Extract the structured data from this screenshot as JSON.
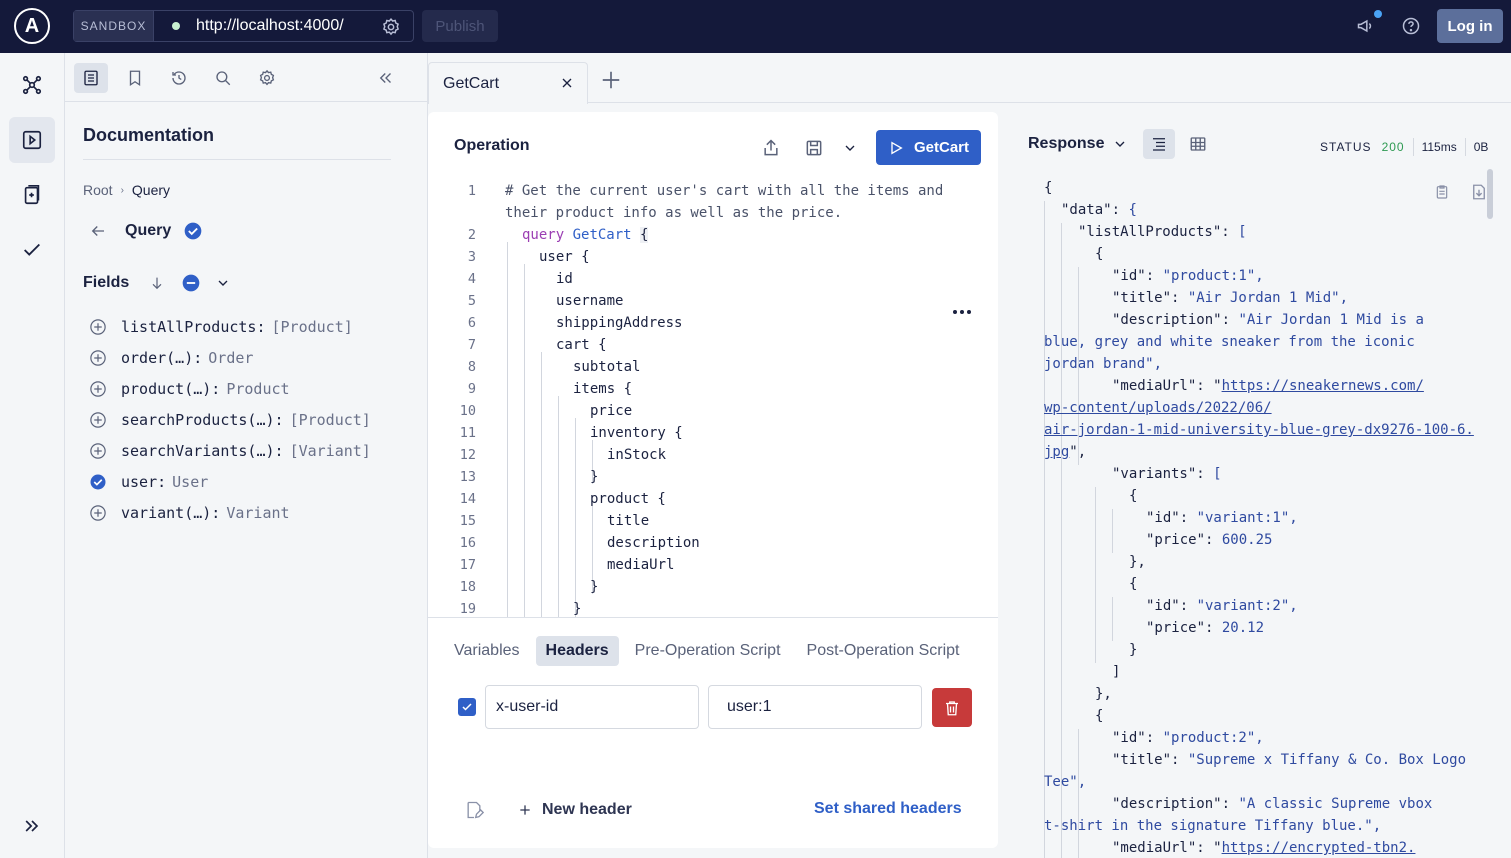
{
  "header": {
    "sandbox_label": "SANDBOX",
    "endpoint_url": "http://localhost:4000/",
    "publish_label": "Publish",
    "login_label": "Log in"
  },
  "docs": {
    "title": "Documentation",
    "breadcrumb": [
      "Root",
      "Query"
    ],
    "query_label": "Query",
    "fields_label": "Fields",
    "fields": [
      {
        "name": "listAllProducts:",
        "type": "[Product]",
        "selected": false
      },
      {
        "name": "order(…):",
        "type": "Order",
        "selected": false
      },
      {
        "name": "product(…):",
        "type": "Product",
        "selected": false
      },
      {
        "name": "searchProducts(…):",
        "type": "[Product]",
        "selected": false
      },
      {
        "name": "searchVariants(…):",
        "type": "[Variant]",
        "selected": false
      },
      {
        "name": "user:",
        "type": "User",
        "selected": true
      },
      {
        "name": "variant(…):",
        "type": "Variant",
        "selected": false
      }
    ]
  },
  "tabs": [
    {
      "label": "GetCart"
    }
  ],
  "operation": {
    "title": "Operation",
    "run_label": "GetCart",
    "lines": [
      {
        "n": "1",
        "text": "# Get the current user's cart with all the items and"
      },
      {
        "n": "",
        "text": "their product info as well as the price."
      },
      {
        "n": "2",
        "kw": "query",
        "name": "GetCart",
        "brace": "{"
      },
      {
        "n": "3",
        "text": "user {"
      },
      {
        "n": "4",
        "text": "id"
      },
      {
        "n": "5",
        "text": "username"
      },
      {
        "n": "6",
        "text": "shippingAddress"
      },
      {
        "n": "7",
        "text": "cart {"
      },
      {
        "n": "8",
        "text": "subtotal"
      },
      {
        "n": "9",
        "text": "items {"
      },
      {
        "n": "10",
        "text": "price"
      },
      {
        "n": "11",
        "text": "inventory {"
      },
      {
        "n": "12",
        "text": "inStock"
      },
      {
        "n": "13",
        "text": "}"
      },
      {
        "n": "14",
        "text": "product {"
      },
      {
        "n": "15",
        "text": "title"
      },
      {
        "n": "16",
        "text": "description"
      },
      {
        "n": "17",
        "text": "mediaUrl"
      },
      {
        "n": "18",
        "text": "}"
      },
      {
        "n": "19",
        "text": "}"
      }
    ]
  },
  "bottom_tabs": [
    "Variables",
    "Headers",
    "Pre-Operation Script",
    "Post-Operation Script"
  ],
  "headers_panel": {
    "key": "x-user-id",
    "value": "user:1",
    "new_header_label": "New header",
    "shared_headers_label": "Set shared headers"
  },
  "response": {
    "title": "Response",
    "status_label": "STATUS",
    "status_code": "200",
    "time": "115ms",
    "size": "0B",
    "lines": [
      {
        "t": "{"
      },
      {
        "t": "\"data\": {"
      },
      {
        "t": "\"listAllProducts\": ["
      },
      {
        "t": "{"
      },
      {
        "t": "\"id\": \"product:1\","
      },
      {
        "t": "\"title\": \"Air Jordan 1 Mid\","
      },
      {
        "t": "\"description\": \"Air Jordan 1 Mid is a"
      },
      {
        "t": "blue, grey and white sneaker from the iconic"
      },
      {
        "t": "jordan brand\","
      },
      {
        "t": "\"mediaUrl\": \"https://sneakernews.com/"
      },
      {
        "t": "wp-content/uploads/2022/06/"
      },
      {
        "t": "air-jordan-1-mid-university-blue-grey-dx9276-100-6."
      },
      {
        "t": "jpg\","
      },
      {
        "t": "\"variants\": ["
      },
      {
        "t": "{"
      },
      {
        "t": "\"id\": \"variant:1\","
      },
      {
        "t": "\"price\": 600.25"
      },
      {
        "t": "},"
      },
      {
        "t": "{"
      },
      {
        "t": "\"id\": \"variant:2\","
      },
      {
        "t": "\"price\": 20.12"
      },
      {
        "t": "}"
      },
      {
        "t": "]"
      },
      {
        "t": "},"
      },
      {
        "t": "{"
      },
      {
        "t": "\"id\": \"product:2\","
      },
      {
        "t": "\"title\": \"Supreme x Tiffany & Co. Box Logo"
      },
      {
        "t": "Tee\","
      },
      {
        "t": "\"description\": \"A classic Supreme vbox"
      },
      {
        "t": "t-shirt in the signature Tiffany blue.\","
      },
      {
        "t": "\"mediaUrl\": \"https://encrypted-tbn2."
      }
    ]
  },
  "colors": {
    "topbar": "#14193a",
    "primary": "#2f5fc7",
    "danger": "#c73a3a",
    "status_ok": "#2e9a52"
  }
}
